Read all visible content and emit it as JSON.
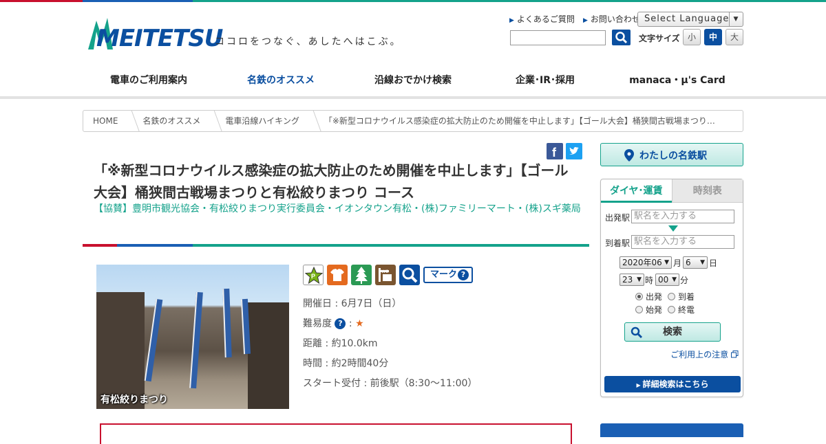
{
  "header": {
    "logo_text": "MEITETSU",
    "tagline": "ココロをつなぐ、あしたへはこぶ。",
    "links": [
      "よくあるご質問",
      "お問い合わせ"
    ],
    "language_select": "Select Language",
    "font_size_label": "文字サイズ",
    "font_sizes": [
      "小",
      "中",
      "大"
    ],
    "brand_blue": "#0b4fa0",
    "brand_green": "#14a28b",
    "brand_red": "#c8102e"
  },
  "nav": {
    "items": [
      "電車のご利用案内",
      "名鉄のオススメ",
      "沿線おでかけ検索",
      "企業･IR･採用",
      "manaca・μ's Card"
    ],
    "active_index": 1
  },
  "breadcrumb": [
    "HOME",
    "名鉄のオススメ",
    "電車沿線ハイキング",
    "「※新型コロナウイルス感染症の拡大防止のため開催を中止します」【ゴール大会】桶狭間古戦場まつり…"
  ],
  "article": {
    "title": "「※新型コロナウイルス感染症の拡大防止のため開催を中止します」【ゴール大会】桶狭間古戦場まつりと有松絞りまつり コース",
    "sponsor": "【協賛】豊明市観光協会・有松絞りまつり実行委員会・イオンタウン有松・(株)ファミリーマート・(株)スギ薬局",
    "photo_caption": "有松絞りまつり",
    "icons": [
      "parking-star-icon",
      "shirt-icon",
      "tree-icon",
      "toilet-icon",
      "search-icon"
    ],
    "mark_label": "マーク",
    "info": {
      "date": "開催日 : 6月7日（日）",
      "difficulty_label": "難易度",
      "difficulty_sep": " : ",
      "difficulty_stars": "★",
      "distance": "距離 : 約10.0km",
      "time": "時間 : 約2時間40分",
      "start": "スタート受付 : 前後駅（8:30～11:00）"
    }
  },
  "sidebar": {
    "my_station": "わたしの名鉄駅",
    "tabs": [
      "ダイヤ･運賃",
      "時刻表"
    ],
    "from_label": "出発駅",
    "to_label": "到着駅",
    "station_placeholder": "駅名を入力する",
    "year_month": "2020年06",
    "month_unit": "月",
    "day": "6",
    "day_unit": "日",
    "hour": "23",
    "hour_unit": "時",
    "minute": "00",
    "minute_unit": "分",
    "radio_options": [
      "出発",
      "到着",
      "始発",
      "終電"
    ],
    "radio_selected": "出発",
    "search_button": "検索",
    "caution_link": "ご利用上の注意",
    "detail_button": "詳細検索はこちら"
  }
}
